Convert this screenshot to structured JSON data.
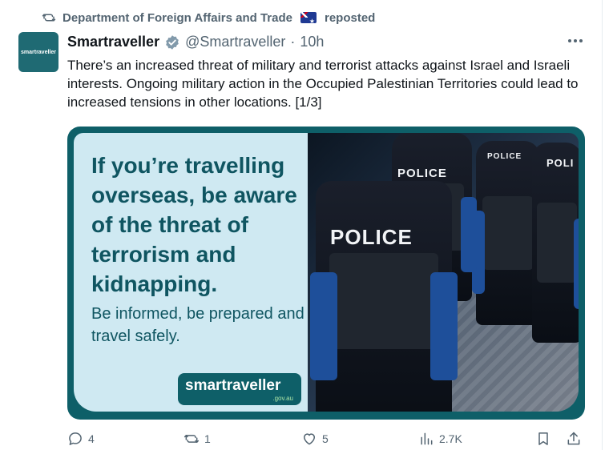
{
  "repost": {
    "account": "Department of Foreign Affairs and Trade",
    "suffix": "reposted",
    "icon": "repost-icon"
  },
  "avatar": {
    "text": "smartraveller"
  },
  "author": {
    "name": "Smartraveller",
    "handle": "@Smartraveller",
    "separator": "·",
    "time": "10h"
  },
  "tweet": {
    "text": "There’s an increased threat of military and terrorist attacks against Israel and Israeli interests. Ongoing military action in the Occupied Palestinian Territories could lead to increased tensions in other locations. [1/3]"
  },
  "media": {
    "headline": "If you’re travelling overseas, be aware of the threat of terrorism and kidnapping.",
    "subline": "Be informed, be prepared and travel safely.",
    "brand": "smartraveller",
    "brand_domain": ".gov.au",
    "photo_labels": [
      "POLICE",
      "POLICE",
      "POLICE",
      "POLI"
    ]
  },
  "actions": {
    "replies": "4",
    "reposts": "1",
    "likes": "5",
    "views": "2.7K"
  },
  "colors": {
    "accent": "#0e5f68",
    "panel": "#cfe9f2",
    "muted": "#536471",
    "verified": "#829aab"
  }
}
